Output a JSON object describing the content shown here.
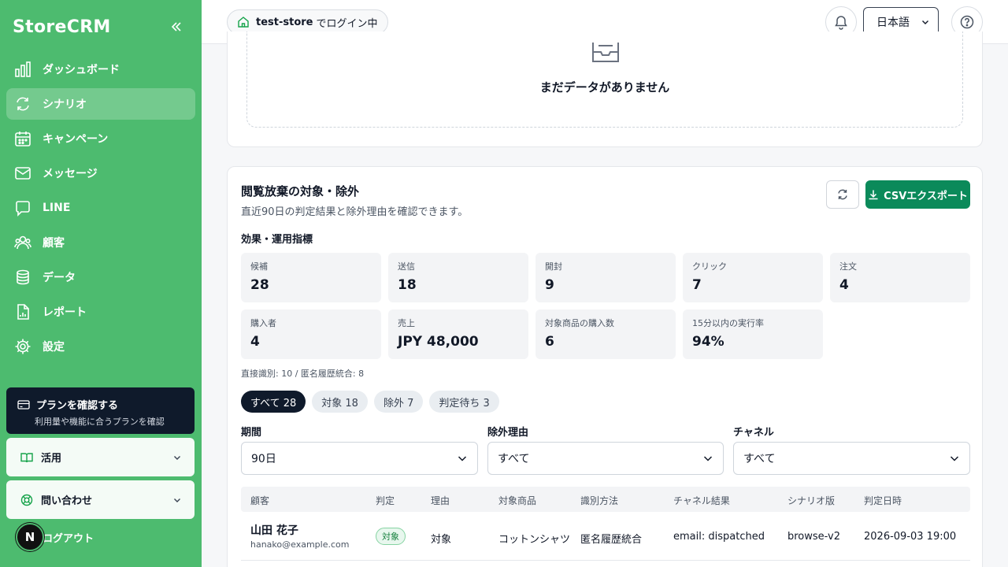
{
  "sidebar": {
    "logo": "StoreCRM",
    "items": [
      {
        "label": "ダッシュボード",
        "icon": "bar-chart-icon"
      },
      {
        "label": "シナリオ",
        "icon": "refresh-cycle-icon",
        "active": true
      },
      {
        "label": "キャンペーン",
        "icon": "calendar-icon"
      },
      {
        "label": "メッセージ",
        "icon": "mail-icon"
      },
      {
        "label": "LINE",
        "icon": "chat-bubble-icon"
      },
      {
        "label": "顧客",
        "icon": "users-icon"
      },
      {
        "label": "データ",
        "icon": "database-icon"
      },
      {
        "label": "レポート",
        "icon": "document-icon"
      },
      {
        "label": "設定",
        "icon": "gear-icon"
      }
    ],
    "plan": {
      "title": "プランを確認する",
      "subtitle": "利用量や機能に合うプランを確認"
    },
    "accordions": [
      {
        "label": "活用"
      },
      {
        "label": "問い合わせ"
      }
    ],
    "logout": {
      "avatar_letter": "N",
      "label": "ログアウト"
    }
  },
  "header": {
    "store_name": "test-store",
    "store_suffix": "でログイン中",
    "language": "日本語"
  },
  "empty_state": {
    "text": "まだデータがありません"
  },
  "section": {
    "title": "閲覧放棄の対象・除外",
    "subtitle": "直近90日の判定結果と除外理由を確認できます。",
    "csv_label": "CSVエクスポート",
    "metrics_label": "効果・運用指標",
    "metrics": [
      {
        "label": "候補",
        "value": "28"
      },
      {
        "label": "送信",
        "value": "18"
      },
      {
        "label": "開封",
        "value": "9"
      },
      {
        "label": "クリック",
        "value": "7"
      },
      {
        "label": "注文",
        "value": "4"
      },
      {
        "label": "購入者",
        "value": "4"
      },
      {
        "label": "売上",
        "value": "JPY 48,000"
      },
      {
        "label": "対象商品の購入数",
        "value": "6"
      },
      {
        "label": "15分以内の実行率",
        "value": "94%"
      }
    ],
    "note": "直接識別: 10 / 匿名履歴統合: 8",
    "chips": [
      "すべて 28",
      "対象 18",
      "除外 7",
      "判定待ち 3"
    ],
    "filters": [
      {
        "label": "期間",
        "value": "90日"
      },
      {
        "label": "除外理由",
        "value": "すべて"
      },
      {
        "label": "チャネル",
        "value": "すべて"
      }
    ],
    "table": {
      "columns": [
        "顧客",
        "判定",
        "理由",
        "対象商品",
        "識別方法",
        "チャネル結果",
        "シナリオ版",
        "判定日時"
      ],
      "rows": [
        {
          "name": "山田 花子",
          "email": "hanako@example.com",
          "verdict": "対象",
          "reason": "対象",
          "product": "コットンシャツ",
          "method": "匿名履歴統合",
          "channel": "email: dispatched",
          "version": "browse-v2",
          "date": "2026-09-03 19:00"
        }
      ]
    }
  },
  "colors": {
    "sidebar": "#4dbb6f",
    "primary": "#0b8a5a",
    "dark": "#0f1a2b"
  }
}
